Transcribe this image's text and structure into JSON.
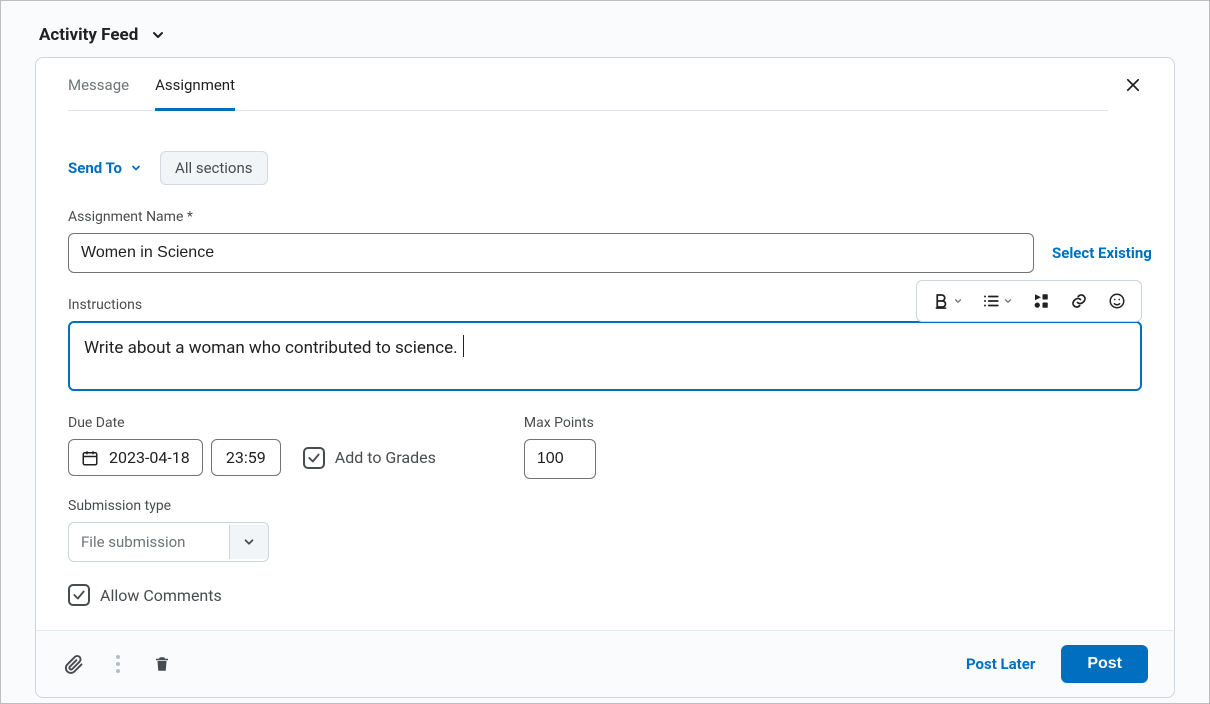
{
  "header": {
    "title": "Activity Feed"
  },
  "tabs": {
    "message": "Message",
    "assignment": "Assignment",
    "active": "assignment"
  },
  "sendto": {
    "label": "Send To",
    "chip": "All sections"
  },
  "form": {
    "assignment_name_label": "Assignment Name *",
    "assignment_name_value": "Women in Science",
    "select_existing": "Select Existing",
    "instructions_label": "Instructions",
    "instructions_value": "Write about a woman who contributed to science.",
    "due_date_label": "Due Date",
    "due_date_value": "2023-04-18",
    "due_time_value": "23:59",
    "add_to_grades_label": "Add to Grades",
    "add_to_grades_checked": true,
    "max_points_label": "Max Points",
    "max_points_value": "100",
    "submission_type_label": "Submission type",
    "submission_type_value": "File submission",
    "allow_comments_label": "Allow Comments",
    "allow_comments_checked": true
  },
  "footer": {
    "post_later": "Post Later",
    "post": "Post"
  }
}
